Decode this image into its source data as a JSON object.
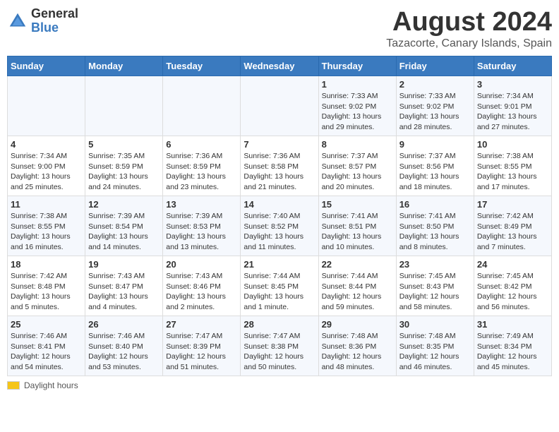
{
  "logo": {
    "general": "General",
    "blue": "Blue"
  },
  "title": "August 2024",
  "subtitle": "Tazacorte, Canary Islands, Spain",
  "days_of_week": [
    "Sunday",
    "Monday",
    "Tuesday",
    "Wednesday",
    "Thursday",
    "Friday",
    "Saturday"
  ],
  "weeks": [
    [
      {
        "day": "",
        "info": ""
      },
      {
        "day": "",
        "info": ""
      },
      {
        "day": "",
        "info": ""
      },
      {
        "day": "",
        "info": ""
      },
      {
        "day": "1",
        "info": "Sunrise: 7:33 AM\nSunset: 9:02 PM\nDaylight: 13 hours\nand 29 minutes."
      },
      {
        "day": "2",
        "info": "Sunrise: 7:33 AM\nSunset: 9:02 PM\nDaylight: 13 hours\nand 28 minutes."
      },
      {
        "day": "3",
        "info": "Sunrise: 7:34 AM\nSunset: 9:01 PM\nDaylight: 13 hours\nand 27 minutes."
      }
    ],
    [
      {
        "day": "4",
        "info": "Sunrise: 7:34 AM\nSunset: 9:00 PM\nDaylight: 13 hours\nand 25 minutes."
      },
      {
        "day": "5",
        "info": "Sunrise: 7:35 AM\nSunset: 8:59 PM\nDaylight: 13 hours\nand 24 minutes."
      },
      {
        "day": "6",
        "info": "Sunrise: 7:36 AM\nSunset: 8:59 PM\nDaylight: 13 hours\nand 23 minutes."
      },
      {
        "day": "7",
        "info": "Sunrise: 7:36 AM\nSunset: 8:58 PM\nDaylight: 13 hours\nand 21 minutes."
      },
      {
        "day": "8",
        "info": "Sunrise: 7:37 AM\nSunset: 8:57 PM\nDaylight: 13 hours\nand 20 minutes."
      },
      {
        "day": "9",
        "info": "Sunrise: 7:37 AM\nSunset: 8:56 PM\nDaylight: 13 hours\nand 18 minutes."
      },
      {
        "day": "10",
        "info": "Sunrise: 7:38 AM\nSunset: 8:55 PM\nDaylight: 13 hours\nand 17 minutes."
      }
    ],
    [
      {
        "day": "11",
        "info": "Sunrise: 7:38 AM\nSunset: 8:55 PM\nDaylight: 13 hours\nand 16 minutes."
      },
      {
        "day": "12",
        "info": "Sunrise: 7:39 AM\nSunset: 8:54 PM\nDaylight: 13 hours\nand 14 minutes."
      },
      {
        "day": "13",
        "info": "Sunrise: 7:39 AM\nSunset: 8:53 PM\nDaylight: 13 hours\nand 13 minutes."
      },
      {
        "day": "14",
        "info": "Sunrise: 7:40 AM\nSunset: 8:52 PM\nDaylight: 13 hours\nand 11 minutes."
      },
      {
        "day": "15",
        "info": "Sunrise: 7:41 AM\nSunset: 8:51 PM\nDaylight: 13 hours\nand 10 minutes."
      },
      {
        "day": "16",
        "info": "Sunrise: 7:41 AM\nSunset: 8:50 PM\nDaylight: 13 hours\nand 8 minutes."
      },
      {
        "day": "17",
        "info": "Sunrise: 7:42 AM\nSunset: 8:49 PM\nDaylight: 13 hours\nand 7 minutes."
      }
    ],
    [
      {
        "day": "18",
        "info": "Sunrise: 7:42 AM\nSunset: 8:48 PM\nDaylight: 13 hours\nand 5 minutes."
      },
      {
        "day": "19",
        "info": "Sunrise: 7:43 AM\nSunset: 8:47 PM\nDaylight: 13 hours\nand 4 minutes."
      },
      {
        "day": "20",
        "info": "Sunrise: 7:43 AM\nSunset: 8:46 PM\nDaylight: 13 hours\nand 2 minutes."
      },
      {
        "day": "21",
        "info": "Sunrise: 7:44 AM\nSunset: 8:45 PM\nDaylight: 13 hours\nand 1 minute."
      },
      {
        "day": "22",
        "info": "Sunrise: 7:44 AM\nSunset: 8:44 PM\nDaylight: 12 hours\nand 59 minutes."
      },
      {
        "day": "23",
        "info": "Sunrise: 7:45 AM\nSunset: 8:43 PM\nDaylight: 12 hours\nand 58 minutes."
      },
      {
        "day": "24",
        "info": "Sunrise: 7:45 AM\nSunset: 8:42 PM\nDaylight: 12 hours\nand 56 minutes."
      }
    ],
    [
      {
        "day": "25",
        "info": "Sunrise: 7:46 AM\nSunset: 8:41 PM\nDaylight: 12 hours\nand 54 minutes."
      },
      {
        "day": "26",
        "info": "Sunrise: 7:46 AM\nSunset: 8:40 PM\nDaylight: 12 hours\nand 53 minutes."
      },
      {
        "day": "27",
        "info": "Sunrise: 7:47 AM\nSunset: 8:39 PM\nDaylight: 12 hours\nand 51 minutes."
      },
      {
        "day": "28",
        "info": "Sunrise: 7:47 AM\nSunset: 8:38 PM\nDaylight: 12 hours\nand 50 minutes."
      },
      {
        "day": "29",
        "info": "Sunrise: 7:48 AM\nSunset: 8:36 PM\nDaylight: 12 hours\nand 48 minutes."
      },
      {
        "day": "30",
        "info": "Sunrise: 7:48 AM\nSunset: 8:35 PM\nDaylight: 12 hours\nand 46 minutes."
      },
      {
        "day": "31",
        "info": "Sunrise: 7:49 AM\nSunset: 8:34 PM\nDaylight: 12 hours\nand 45 minutes."
      }
    ]
  ],
  "footer": {
    "daylight_label": "Daylight hours"
  }
}
